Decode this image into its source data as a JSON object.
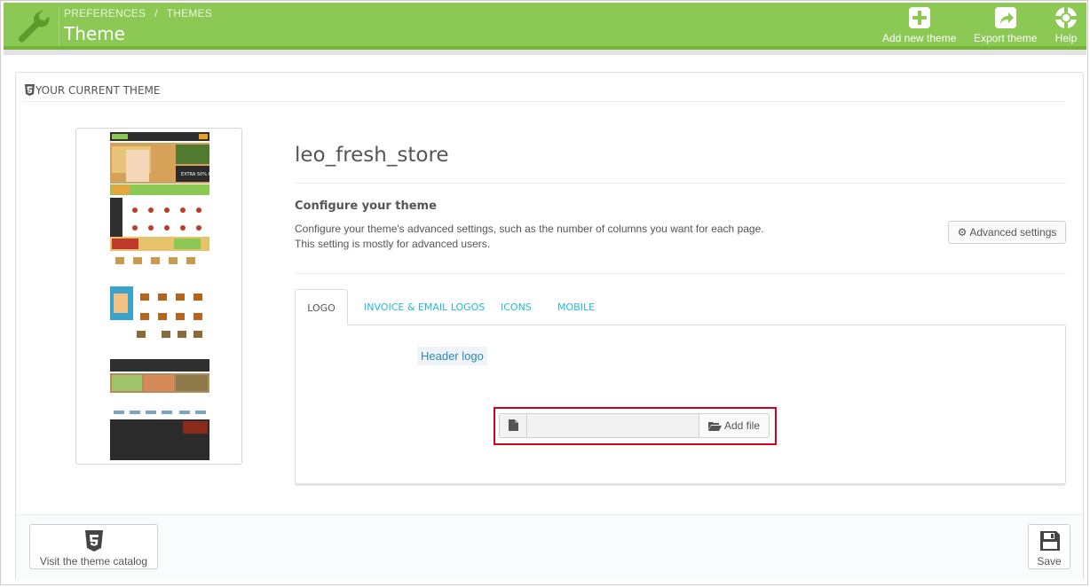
{
  "header": {
    "breadcrumb": [
      "PREFERENCES",
      "/",
      "THEMES"
    ],
    "title": "Theme",
    "tools": [
      {
        "label": "Add new theme",
        "icon": "plus-icon"
      },
      {
        "label": "Export theme",
        "icon": "export-icon"
      },
      {
        "label": "Help",
        "icon": "lifebuoy-icon"
      }
    ]
  },
  "panel": {
    "heading": "YOUR CURRENT THEME",
    "theme_name": "leo_fresh_store",
    "configure_title": "Configure your theme",
    "configure_desc_1": "Configure your theme's advanced settings, such as the number of columns you want for each page.",
    "configure_desc_2": "This setting is mostly for advanced users.",
    "advanced_button": "Advanced settings"
  },
  "tabs": [
    {
      "label": "LOGO",
      "active": true
    },
    {
      "label": "INVOICE & EMAIL LOGOS",
      "active": false
    },
    {
      "label": "ICONS",
      "active": false
    },
    {
      "label": "MOBILE",
      "active": false
    }
  ],
  "logo_tab": {
    "header_logo_label": "Header logo",
    "file_value": "",
    "add_file_label": "Add file"
  },
  "footer": {
    "catalog_button": "Visit the theme catalog",
    "save_button": "Save"
  },
  "colors": {
    "header_bg": "#8bc954",
    "link": "#25b9d7",
    "highlight_border": "#d0021b"
  }
}
